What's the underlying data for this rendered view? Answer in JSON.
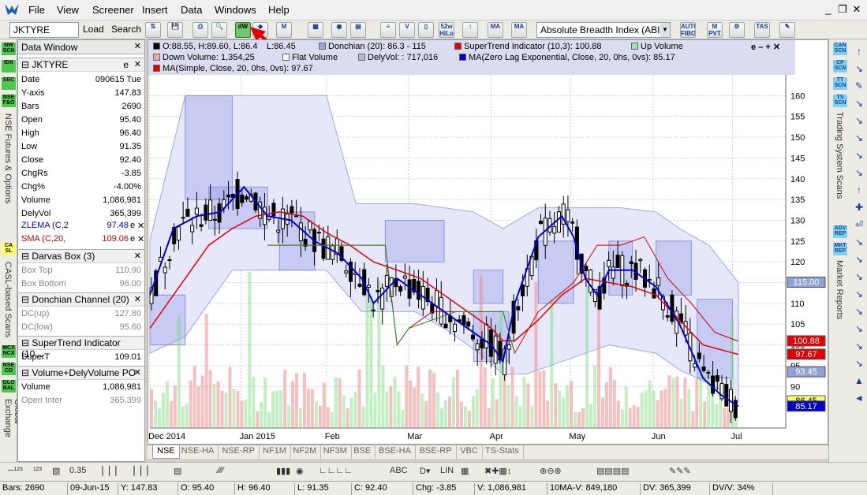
{
  "menu": {
    "items": [
      "File",
      "View",
      "Screener",
      "Insert",
      "Data",
      "Windows",
      "Help"
    ]
  },
  "toolbar": {
    "symbol_value": "JKTYRE",
    "load_label": "Load",
    "search_label": "Search",
    "indicator_selected": "Absolute Breadth Index (ABI",
    "icon_labels": [
      "dW",
      "52w HiLo",
      "MA",
      "MA",
      "AUTO FIBO",
      "M PVT",
      "TAS"
    ]
  },
  "left_strip": {
    "buttons": [
      "NW SCN",
      "IDX",
      "SEC",
      "NSE F&O",
      "CA SL",
      "MCX NCX",
      "NSE CD",
      "GLO BAL"
    ],
    "labels": [
      "NSE Futures & Options",
      "CASL-based Scans",
      "Global Exchange"
    ]
  },
  "data_window": {
    "title": "Data Window",
    "symbol": "JKTYRE",
    "rows": [
      {
        "k": "Date",
        "v": "090615 Tue"
      },
      {
        "k": "Y-axis",
        "v": "147.83"
      },
      {
        "k": "Bars",
        "v": "2690"
      },
      {
        "k": "Open",
        "v": "95.40"
      },
      {
        "k": "High",
        "v": "96.40"
      },
      {
        "k": "Low",
        "v": "91.35"
      },
      {
        "k": "Close",
        "v": "92.40"
      },
      {
        "k": "ChgRs",
        "v": "-3.85"
      },
      {
        "k": "Chg%",
        "v": "-4.00%"
      },
      {
        "k": "Volume",
        "v": "1,086,981"
      },
      {
        "k": "DelyVol",
        "v": "365,399"
      }
    ],
    "zlema": {
      "k": "ZLEMA (C,2",
      "v": "97.48"
    },
    "sma": {
      "k": "SMA (C,20,",
      "v": "109.06"
    },
    "darvas": {
      "title": "Darvas Box (3)",
      "top_k": "Box Top",
      "top_v": "110.90",
      "bot_k": "Box Bottom",
      "bot_v": "96.00"
    },
    "donchian": {
      "title": "Donchian Channel (20)",
      "up_k": "DC(up)",
      "up_v": "127.80",
      "low_k": "DC(low)",
      "low_v": "95.60"
    },
    "supertrend": {
      "title": "SuperTrend Indicator (10...",
      "k": "SuperT",
      "v": "109.01"
    },
    "volume": {
      "title": "Volume+DelyVolume PO",
      "vol_k": "Volume",
      "vol_v": "1,086,981",
      "oi_k": "Open Inter",
      "oi_v": "365,399"
    },
    "e_label": "e",
    "x_label": "✕"
  },
  "chart": {
    "legend": {
      "ohlc": "O:88.55, H:89.60, L:86.4",
      "ohlc2": "L:86.45",
      "donchian": "Donchian (20): 86.3 - 115",
      "supertrend": "SuperTrend Indicator  (10,3): 100.88",
      "upvol": "Up Volume",
      "downvol": "Down Volume: 1,354,25",
      "flatvol": "Flat Volume",
      "delyvol": "DelyVol: : 717,016",
      "zlema": "MA(Zero Lag Exponential, Close, 20, 0hs, 0vs): 85.17",
      "sma": "MA(Simple, Close, 20, 0hs, 0vs): 97.67",
      "ctl": "e – + ✕"
    },
    "price_tags": [
      {
        "label": "115.00",
        "color": "#8ea2d6"
      },
      {
        "label": "100.88",
        "color": "#e00000"
      },
      {
        "label": "97.67",
        "color": "#e00000"
      },
      {
        "label": "93.45",
        "color": "#8ea2d6"
      },
      {
        "label": "86.45",
        "color": "#ffff66"
      },
      {
        "label": "85.17",
        "color": "#0000cc"
      }
    ],
    "tabs": [
      "NSE",
      "NSE-HA",
      "NSE-RP",
      "NF1M",
      "NF2M",
      "NF3M",
      "BSE",
      "BSE-HA",
      "BSE-RP",
      "VBC",
      "TS-Stats"
    ]
  },
  "chart_data": {
    "type": "candlestick",
    "title": "",
    "ylim": [
      80,
      165
    ],
    "y_ticks": [
      90,
      95,
      100,
      105,
      110,
      115,
      120,
      125,
      130,
      135,
      140,
      145,
      150,
      155,
      160
    ],
    "x_labels": [
      "Dec 2014",
      "Jan 2015",
      "Feb",
      "Mar",
      "Apr",
      "May",
      "Jun",
      "Jul"
    ],
    "sma20_points": [
      [
        0,
        104
      ],
      [
        0.05,
        114
      ],
      [
        0.1,
        124
      ],
      [
        0.14,
        128
      ],
      [
        0.18,
        131
      ],
      [
        0.22,
        132
      ],
      [
        0.26,
        131
      ],
      [
        0.3,
        127
      ],
      [
        0.34,
        124
      ],
      [
        0.38,
        120
      ],
      [
        0.42,
        118
      ],
      [
        0.46,
        116
      ],
      [
        0.5,
        112
      ],
      [
        0.54,
        108
      ],
      [
        0.58,
        104
      ],
      [
        0.6,
        101
      ],
      [
        0.62,
        101
      ],
      [
        0.66,
        106
      ],
      [
        0.7,
        112
      ],
      [
        0.74,
        116
      ],
      [
        0.78,
        115
      ],
      [
        0.82,
        114
      ],
      [
        0.86,
        112
      ],
      [
        0.9,
        106
      ],
      [
        0.94,
        100
      ],
      [
        1.0,
        97.7
      ]
    ],
    "zlema_points": [
      [
        0,
        112
      ],
      [
        0.04,
        128
      ],
      [
        0.08,
        131
      ],
      [
        0.12,
        132
      ],
      [
        0.16,
        138
      ],
      [
        0.2,
        131
      ],
      [
        0.24,
        130
      ],
      [
        0.28,
        125
      ],
      [
        0.32,
        122
      ],
      [
        0.36,
        116
      ],
      [
        0.38,
        110
      ],
      [
        0.42,
        116
      ],
      [
        0.46,
        112
      ],
      [
        0.5,
        108
      ],
      [
        0.54,
        104
      ],
      [
        0.58,
        100
      ],
      [
        0.6,
        96
      ],
      [
        0.62,
        110
      ],
      [
        0.66,
        126
      ],
      [
        0.7,
        131
      ],
      [
        0.72,
        126
      ],
      [
        0.74,
        116
      ],
      [
        0.76,
        112
      ],
      [
        0.78,
        118
      ],
      [
        0.82,
        118
      ],
      [
        0.86,
        114
      ],
      [
        0.9,
        105
      ],
      [
        0.94,
        92
      ],
      [
        0.97,
        88
      ],
      [
        1.0,
        85.2
      ]
    ],
    "supertrend_points": [
      [
        0.2,
        124
      ],
      [
        0.35,
        124
      ],
      [
        0.4,
        124
      ],
      [
        0.42,
        100
      ],
      [
        0.44,
        104
      ],
      [
        0.48,
        108
      ],
      [
        0.52,
        108
      ],
      [
        0.6,
        108
      ],
      [
        0.62,
        98
      ],
      [
        0.66,
        108
      ],
      [
        0.72,
        115
      ],
      [
        0.76,
        124
      ],
      [
        0.8,
        124
      ],
      [
        0.84,
        126
      ],
      [
        0.88,
        116
      ],
      [
        0.92,
        110
      ],
      [
        0.96,
        103
      ],
      [
        1.0,
        100.9
      ]
    ],
    "donchian_upper": [
      [
        0,
        125
      ],
      [
        0.06,
        160
      ],
      [
        0.2,
        160
      ],
      [
        0.3,
        160
      ],
      [
        0.35,
        134
      ],
      [
        0.45,
        134
      ],
      [
        0.55,
        132
      ],
      [
        0.6,
        128
      ],
      [
        0.66,
        133
      ],
      [
        0.8,
        133
      ],
      [
        0.86,
        132
      ],
      [
        0.9,
        128
      ],
      [
        0.95,
        124
      ],
      [
        1.0,
        115
      ]
    ],
    "donchian_lower": [
      [
        0,
        98
      ],
      [
        0.06,
        102
      ],
      [
        0.14,
        118
      ],
      [
        0.22,
        118
      ],
      [
        0.3,
        118
      ],
      [
        0.36,
        108
      ],
      [
        0.45,
        108
      ],
      [
        0.5,
        104
      ],
      [
        0.56,
        98
      ],
      [
        0.6,
        93
      ],
      [
        0.64,
        93
      ],
      [
        0.7,
        96
      ],
      [
        0.78,
        100
      ],
      [
        0.86,
        98
      ],
      [
        0.9,
        94
      ],
      [
        0.96,
        90
      ],
      [
        1.0,
        86.3
      ]
    ]
  },
  "right_strip": {
    "buttons": [
      "CAN SCN",
      "CP SCN",
      "TT SCN",
      "TS SCN",
      "ADV REP",
      "MKT REP"
    ],
    "labels": [
      "Trading System Scans",
      "Market Reports"
    ]
  },
  "status": {
    "bars": "Bars: 2690",
    "date": "09-Jun-15",
    "y": "Y: 147.83",
    "o": "O: 95.40",
    "h": "H: 96.40",
    "l": "L: 91.35",
    "c": "C: 92.40",
    "chg": "Chg: -3.85",
    "v": "V: 1,086,981",
    "ma": "10MA-V: 849,180",
    "dv": "DV: 365,399",
    "dvv": "DV/V: 34%"
  }
}
